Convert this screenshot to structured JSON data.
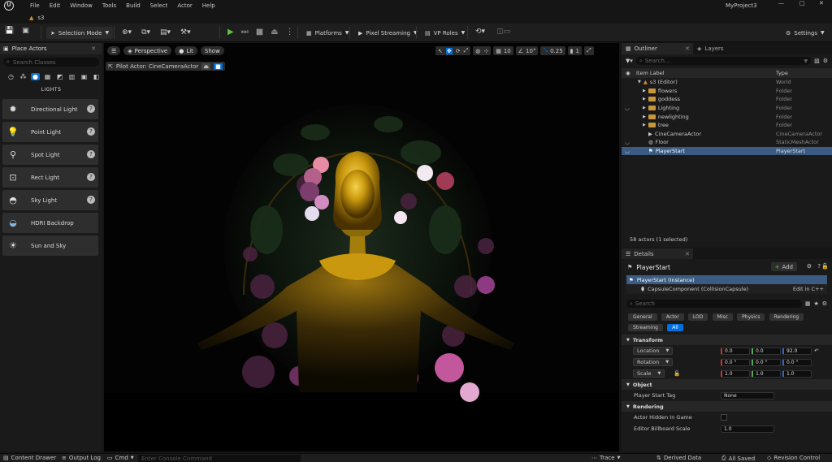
{
  "menu": [
    "File",
    "Edit",
    "Window",
    "Tools",
    "Build",
    "Select",
    "Actor",
    "Help"
  ],
  "project_name": "MyProject3",
  "level_tab": "s3",
  "toolbar": {
    "selection_mode": "Selection Mode",
    "platforms": "Platforms",
    "pixel_streaming": "Pixel Streaming",
    "vp_roles": "VP Roles",
    "settings": "Settings"
  },
  "place_actors": {
    "title": "Place Actors",
    "search_placeholder": "Search Classes",
    "category": "LIGHTS",
    "items": [
      {
        "label": "Directional Light",
        "icon": "directional-light-icon"
      },
      {
        "label": "Point Light",
        "icon": "point-light-icon"
      },
      {
        "label": "Spot Light",
        "icon": "spot-light-icon"
      },
      {
        "label": "Rect Light",
        "icon": "rect-light-icon"
      },
      {
        "label": "Sky Light",
        "icon": "sky-light-icon"
      },
      {
        "label": "HDRI Backdrop",
        "icon": "hdri-backdrop-icon"
      },
      {
        "label": "Sun and Sky",
        "icon": "sun-and-sky-icon"
      }
    ]
  },
  "viewport": {
    "perspective": "Perspective",
    "lit": "Lit",
    "show": "Show",
    "pilot": "Pilot Actor: CineCameraActor",
    "grid_snap": "10",
    "rot_snap": "10°",
    "scale_snap": "0.25",
    "cam_speed": "1"
  },
  "outliner": {
    "tab": "Outliner",
    "tab2": "Layers",
    "search_placeholder": "Search...",
    "col_label": "Item Label",
    "col_type": "Type",
    "rows": [
      {
        "label": "s3 (Editor)",
        "type": "World"
      },
      {
        "label": "flowers",
        "type": "Folder"
      },
      {
        "label": "goddess",
        "type": "Folder"
      },
      {
        "label": "Lighting",
        "type": "Folder"
      },
      {
        "label": "newlighting",
        "type": "Folder"
      },
      {
        "label": "tree",
        "type": "Folder"
      },
      {
        "label": "CineCameraActor",
        "type": "CineCameraActor"
      },
      {
        "label": "Floor",
        "type": "StaticMeshActor"
      },
      {
        "label": "PlayerStart",
        "type": "PlayerStart"
      }
    ],
    "footer": "58 actors (1 selected)"
  },
  "details": {
    "tab": "Details",
    "actor": "PlayerStart",
    "add": "Add",
    "instance": "PlayerStart (Instance)",
    "component": "CapsuleComponent (CollisionCapsule)",
    "edit_cpp": "Edit in C++",
    "search_placeholder": "Search",
    "categories": [
      "General",
      "Actor",
      "LOD",
      "Misc",
      "Physics",
      "Rendering",
      "Streaming",
      "All"
    ],
    "transform": "Transform",
    "location": {
      "label": "Location",
      "x": "0.0",
      "y": "0.0",
      "z": "92.0"
    },
    "rotation": {
      "label": "Rotation",
      "x": "0.0 °",
      "y": "0.0 °",
      "z": "0.0 °"
    },
    "scale": {
      "label": "Scale",
      "x": "1.0",
      "y": "1.0",
      "z": "1.0"
    },
    "object": "Object",
    "player_start_tag": "Player Start Tag",
    "player_start_tag_value": "None",
    "rendering": "Rendering",
    "actor_hidden": "Actor Hidden In Game",
    "billboard_scale": "Editor Billboard Scale",
    "billboard_value": "1.0"
  },
  "status": {
    "content_drawer": "Content Drawer",
    "output_log": "Output Log",
    "cmd": "Cmd",
    "console_placeholder": "Enter Console Command",
    "trace": "Trace",
    "derived_data": "Derived Data",
    "all_saved": "All Saved",
    "revision_control": "Revision Control"
  },
  "colors": {
    "accent": "#0070e0",
    "play": "#5fbf3a",
    "folder": "#c8973b",
    "selected_row": "#3b5b82"
  }
}
